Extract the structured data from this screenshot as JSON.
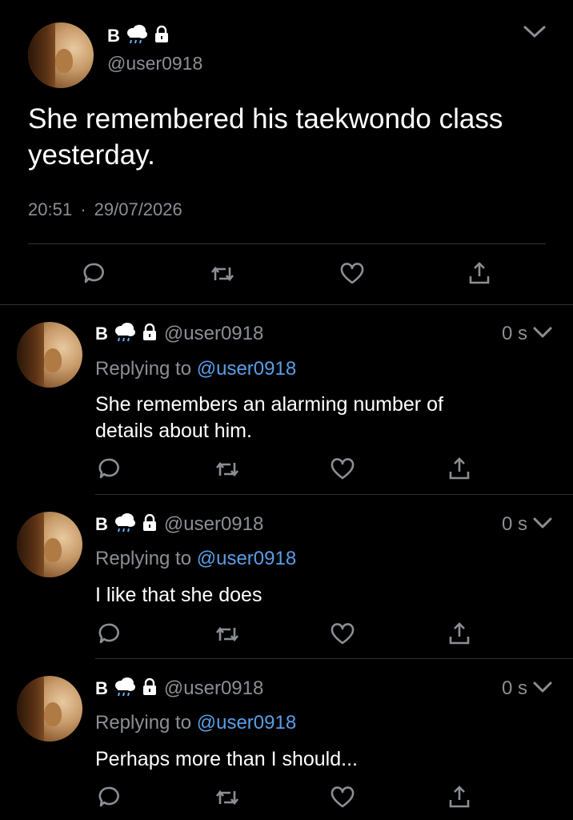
{
  "main_tweet": {
    "name": "B",
    "handle": "@user0918",
    "text_line1": "She remembered his taekwondo class",
    "text_line2": "yesterday.",
    "time": "20:51",
    "separator": "·",
    "date": "29/07/2026"
  },
  "replies": [
    {
      "name": "B",
      "handle": "@user0918",
      "time_ago": "0 s",
      "replying_prefix": "Replying to",
      "replying_to": "@user0918",
      "text_line1": "She remembers an alarming number of",
      "text_line2": "details about him."
    },
    {
      "name": "B",
      "handle": "@user0918",
      "time_ago": "0 s",
      "replying_prefix": "Replying to",
      "replying_to": "@user0918",
      "text_line1": "I like that she does",
      "text_line2": ""
    },
    {
      "name": "B",
      "handle": "@user0918",
      "time_ago": "0 s",
      "replying_prefix": "Replying to",
      "replying_to": "@user0918",
      "text_line1": "Perhaps more than I should...",
      "text_line2": ""
    }
  ],
  "colors": {
    "background": "#000000",
    "muted": "#8b8f94",
    "link": "#5a9ee6",
    "divider": "#2f3336"
  },
  "icons": [
    "rain-cloud-icon",
    "lock-icon",
    "chevron-down-icon",
    "reply-icon",
    "retweet-icon",
    "like-icon",
    "share-icon"
  ]
}
